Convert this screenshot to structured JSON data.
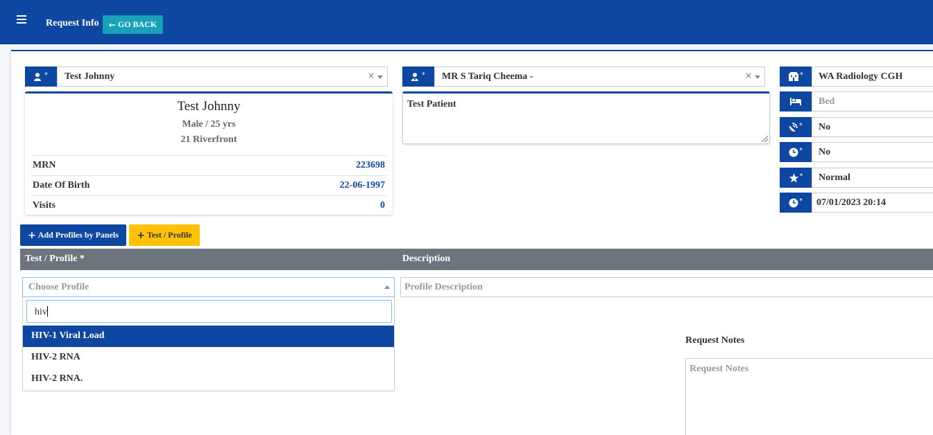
{
  "header": {
    "title": "Request Info",
    "go_back_label": "GO BACK"
  },
  "patient_select": {
    "value": "Test Johnny",
    "clear": "×"
  },
  "patient": {
    "name": "Test Johnny",
    "gender_age": "Male / 25 yrs",
    "address": "21 Riverfront",
    "rows": [
      {
        "label": "MRN",
        "value": "223698"
      },
      {
        "label": "Date Of Birth",
        "value": "22-06-1997"
      },
      {
        "label": "Visits",
        "value": "0"
      }
    ]
  },
  "doctor_select": {
    "value": "MR S Tariq Cheema -",
    "clear": "×"
  },
  "clinical_notes": {
    "value": "Test Patient"
  },
  "right_fields": {
    "location": "WA Radiology CGH",
    "bed_placeholder": "Bed",
    "field3": "No",
    "field4": "No",
    "priority": "Normal",
    "datetime": "07/01/2023 20:14"
  },
  "buttons": {
    "add_profiles": "Add Profiles by Panels",
    "test_profile": "Test / Profile"
  },
  "table": {
    "col1": "Test / Profile *",
    "col2": "Description"
  },
  "profile_select": {
    "placeholder": "Choose Profile",
    "search_value": "hiv"
  },
  "profile_description": {
    "placeholder": "Profile Description"
  },
  "dropdown_options": [
    "HIV-1 Viral Load",
    "HIV-2 RNA",
    "HIV-2 RNA."
  ],
  "request_notes": {
    "label": "Request Notes",
    "placeholder": "Request Notes"
  },
  "icons": {
    "menu": "hamburger-icon",
    "back": "arrow-left-icon",
    "user": "user-plus-icon",
    "doctor": "user-md-icon",
    "hospital": "hospital-icon",
    "bed": "bed-icon",
    "radiation": "satellite-dish-icon",
    "clock": "clock-icon",
    "star": "star-icon"
  },
  "colors": {
    "primary": "#0d47a1",
    "info": "#17a2b8",
    "warning": "#ffc107",
    "table_header": "#6c757d"
  }
}
